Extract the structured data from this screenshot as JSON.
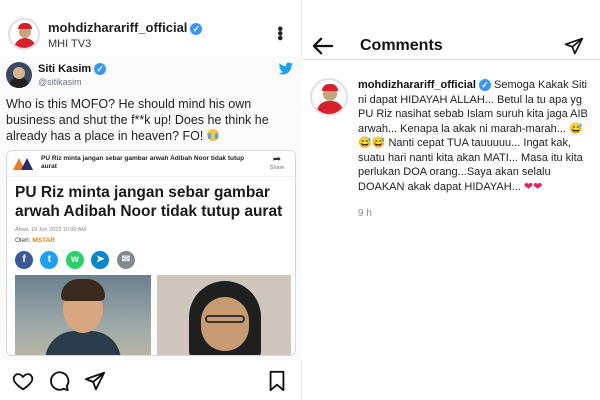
{
  "post": {
    "username": "mohdizharariff_official",
    "subtitle": "MHI TV3",
    "more_icon": "more-vertical-icon",
    "tweet": {
      "name": "Siti Kasim",
      "handle": "@sitikasim",
      "text": "Who is this MOFO? He should mind his own business and shut the f**k up! Does he think he already has a place in heaven? FO!",
      "emoji": "crying-face",
      "article": {
        "mini_title": "PU Riz minta jangan sebar gambar arwah Adibah Noor tidak tutup aurat",
        "share_label": "Share",
        "headline": "PU Riz minta jangan sebar gambar arwah Adibah Noor tidak tutup aurat",
        "date": "Ahad, 19 Jun 2022 10:00 AM",
        "by_label": "Oleh:",
        "by_source": "MSTAR",
        "share_buttons": [
          {
            "name": "facebook",
            "glyph": "f",
            "color": "#3b5998"
          },
          {
            "name": "twitter",
            "glyph": "t",
            "color": "#1da1f2"
          },
          {
            "name": "whatsapp",
            "glyph": "w",
            "color": "#25d366"
          },
          {
            "name": "telegram",
            "glyph": "➤",
            "color": "#0088cc"
          },
          {
            "name": "email",
            "glyph": "✉",
            "color": "#7f8c8d"
          }
        ]
      }
    },
    "actions": [
      "heart-icon",
      "comment-icon",
      "share-icon",
      "bookmark-icon"
    ]
  },
  "comments": {
    "title": "Comments",
    "comment": {
      "username": "mohdizharariff_official",
      "text": " Semoga Kakak Siti ni dapat HIDAYAH ALLAH... Betul la tu apa yg PU Riz nasihat sebab Islam suruh kita jaga AIB arwah... Kenapa la akak ni marah-marah... 😅😅😅 Nanti cepat TUA tauuuuu... Ingat kak, suatu hari nanti kita akan MATI... Masa itu kita perlukan DOA orang...Saya akan selalu DOAKAN akak dapat HIDAYAH... ",
      "hearts": "❤❤",
      "time": "9 h"
    }
  },
  "colors": {
    "verified": "#3897f0",
    "accent_red": "#e0245e",
    "mstar_orange": "#e67e22"
  }
}
